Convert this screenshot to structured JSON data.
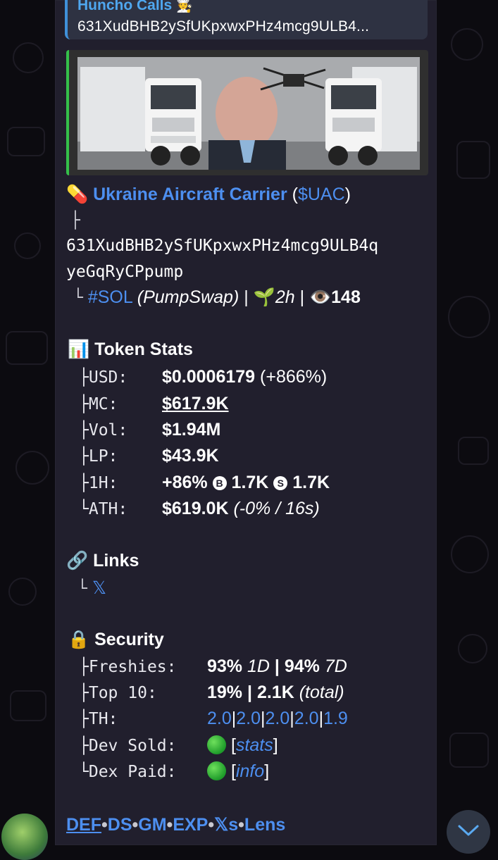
{
  "reply": {
    "name": "Huncho Calls",
    "name_emoji": "🧑‍🍳",
    "ca": "631XudBHB2ySfUKpxwxPHz4mcg9ULB4..."
  },
  "token": {
    "pill_emoji": "💊",
    "name": "Ukraine Aircraft Carrier",
    "ticker_open": "(",
    "ticker": "$UAC",
    "ticker_close": ")",
    "ca_line1": "631XudBHB2ySfUKpxwxPHz4mcg9ULB4q",
    "ca_line2": "yeGqRyCPpump",
    "chain": "#SOL",
    "dex": "(PumpSwap)",
    "sep1": " | ",
    "sprout_emoji": "🌱",
    "age": "2h",
    "sep2": " | ",
    "eye_emoji": "👁️",
    "views": "148"
  },
  "stats": {
    "icon": "📊",
    "title": "Token Stats",
    "usd_key": "USD:",
    "usd_val": "$0.0006179",
    "usd_change": "(+866%)",
    "mc_key": "MC:",
    "mc_val": "$617.9K",
    "vol_key": "Vol:",
    "vol_val": "$1.94M",
    "lp_key": "LP:",
    "lp_val": "$43.9K",
    "h1_key": "1H:",
    "h1_change": "+86%",
    "h1_buy_icon": "B",
    "h1_buy": "1.7K",
    "h1_sell_icon": "S",
    "h1_sell": "1.7K",
    "ath_key": "ATH:",
    "ath_val": "$619.0K",
    "ath_note": "(-0% / 16s)"
  },
  "links": {
    "icon": "🔗",
    "title": "Links",
    "x_label": "𝕏"
  },
  "security": {
    "icon": "🔒",
    "title": "Security",
    "fresh_key": "Freshies:",
    "fresh_1d": "93%",
    "fresh_1d_label": "1D",
    "fresh_sep": " | ",
    "fresh_7d": "94%",
    "fresh_7d_label": "7D",
    "top10_key": "Top 10:",
    "top10_pct": "19%",
    "top10_sep": " | ",
    "top10_total": "2.1K",
    "top10_total_label": "(total)",
    "th_key": "TH:",
    "th_vals": [
      "2.0",
      "2.0",
      "2.0",
      "2.0",
      "1.9"
    ],
    "devsold_key": "Dev Sold:",
    "devsold_link": "stats",
    "dexpaid_key": "Dex Paid:",
    "dexpaid_link": "info"
  },
  "footer_links": [
    "DEF",
    "DS",
    "GM",
    "EXP",
    "𝕏s",
    "Lens"
  ],
  "colors": {
    "accent_blue": "#4d8ff0",
    "bubble_bg": "#211f2d",
    "status_green": "#1e9b2a"
  }
}
